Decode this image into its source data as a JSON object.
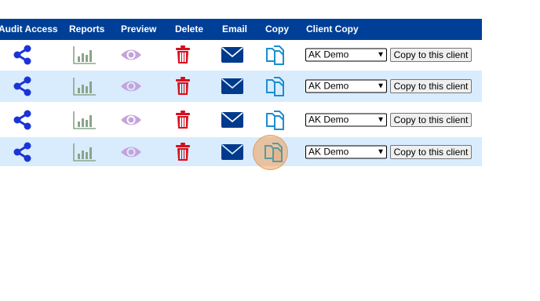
{
  "header": {
    "audit_access": "Audit Access",
    "reports": "Reports",
    "preview": "Preview",
    "delete": "Delete",
    "email": "Email",
    "copy": "Copy",
    "client_copy": "Client Copy"
  },
  "rows": [
    {
      "client_select": "AK Demo",
      "copy_button": "Copy to this client"
    },
    {
      "client_select": "AK Demo",
      "copy_button": "Copy to this client"
    },
    {
      "client_select": "AK Demo",
      "copy_button": "Copy to this client"
    },
    {
      "client_select": "AK Demo",
      "copy_button": "Copy to this client"
    }
  ],
  "icons": {
    "audit_access": "share-icon",
    "reports": "bar-chart-icon",
    "preview": "eye-icon",
    "delete": "trash-icon",
    "email": "envelope-icon",
    "copy": "copy-icon"
  },
  "colors": {
    "header_bg": "#003f97",
    "alt_row_bg": "#d9ecfd",
    "share": "#1a34d6",
    "reports": "#8aa58a",
    "preview": "#c4a3dc",
    "delete": "#d60f1f",
    "email": "#003a8c",
    "copy": "#1b8ed0"
  }
}
